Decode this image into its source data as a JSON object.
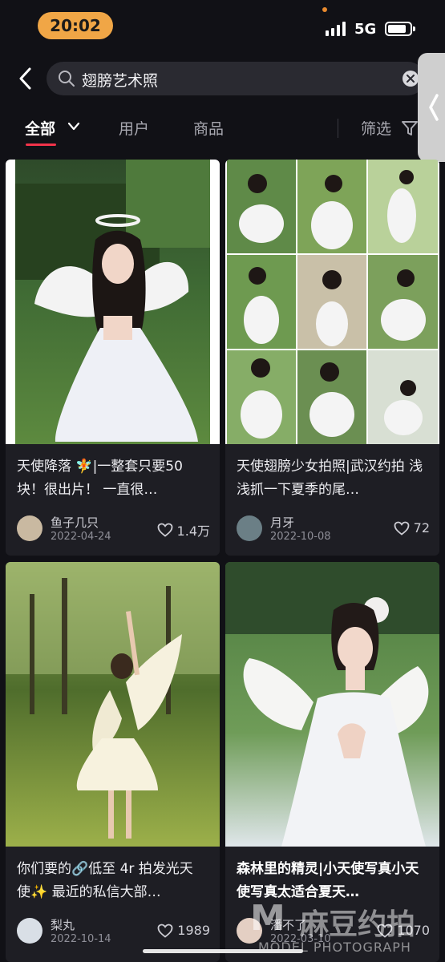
{
  "status": {
    "time": "20:02",
    "network": "5G"
  },
  "search": {
    "query": "翅膀艺术照"
  },
  "tabs": [
    {
      "label": "全部"
    },
    {
      "label": "用户"
    },
    {
      "label": "商品"
    },
    {
      "label": "筛选"
    }
  ],
  "cards": [
    {
      "title": "天使降落 🧚|一整套只要50块！很出片！ 一直很…",
      "author": "鱼子几只",
      "date": "2022-04-24",
      "likes": "1.4万"
    },
    {
      "title": "天使翅膀少女拍照|武汉约拍 浅浅抓一下夏季的尾…",
      "author": "月牙",
      "date": "2022-10-08",
      "likes": "72"
    },
    {
      "title": "你们要的🔗低至 4r 拍发光天使✨ 最近的私信大部…",
      "author": "梨丸",
      "date": "2022-10-14",
      "likes": "1989"
    },
    {
      "title": "森林里的精灵|小天使写真小天使写真太适合夏天…",
      "author": "潘不了",
      "date": "2022-03-10",
      "likes": "1070"
    }
  ],
  "watermark": {
    "logo": "M",
    "cn": "麻豆约拍",
    "en": "MODEL PHOTOGRAPH"
  },
  "icons": {
    "back": "chevron-left-icon",
    "search": "search-icon",
    "clear": "clear-icon",
    "tab_dropdown": "chevron-down-icon",
    "filter": "filter-icon",
    "like": "heart-icon",
    "side_handle": "chevron-left-icon"
  },
  "colors": {
    "accent": "#f2334a",
    "time_pill": "#f0a646",
    "background": "#111116",
    "card": "#1e1e24"
  }
}
